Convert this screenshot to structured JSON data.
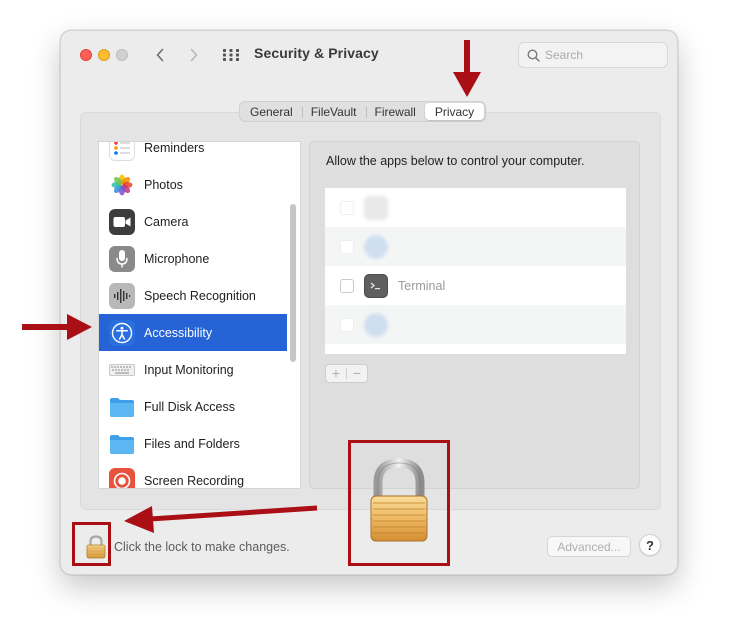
{
  "window": {
    "title": "Security & Privacy",
    "search_placeholder": "Search"
  },
  "tabs": [
    {
      "label": "General",
      "active": false
    },
    {
      "label": "FileVault",
      "active": false
    },
    {
      "label": "Firewall",
      "active": false
    },
    {
      "label": "Privacy",
      "active": true
    }
  ],
  "sidebar": {
    "items": [
      {
        "label": "Reminders",
        "icon": "reminders-icon"
      },
      {
        "label": "Photos",
        "icon": "photos-icon"
      },
      {
        "label": "Camera",
        "icon": "camera-icon"
      },
      {
        "label": "Microphone",
        "icon": "microphone-icon"
      },
      {
        "label": "Speech Recognition",
        "icon": "speech-recognition-icon"
      },
      {
        "label": "Accessibility",
        "icon": "accessibility-icon",
        "selected": true
      },
      {
        "label": "Input Monitoring",
        "icon": "keyboard-icon"
      },
      {
        "label": "Full Disk Access",
        "icon": "folder-icon"
      },
      {
        "label": "Files and Folders",
        "icon": "folder-icon"
      },
      {
        "label": "Screen Recording",
        "icon": "screen-recording-icon"
      }
    ]
  },
  "main": {
    "heading": "Allow the apps below to control your computer.",
    "apps": [
      {
        "name": "Terminal",
        "checked": false
      }
    ],
    "plus_label": "+",
    "minus_label": "−"
  },
  "footer": {
    "lock_text": "Click the lock to make changes.",
    "advanced_label": "Advanced...",
    "help_label": "?"
  },
  "colors": {
    "selection": "#2563d6",
    "annotation": "#a90f15",
    "close": "#fe5f57",
    "minimize": "#febc2e"
  }
}
